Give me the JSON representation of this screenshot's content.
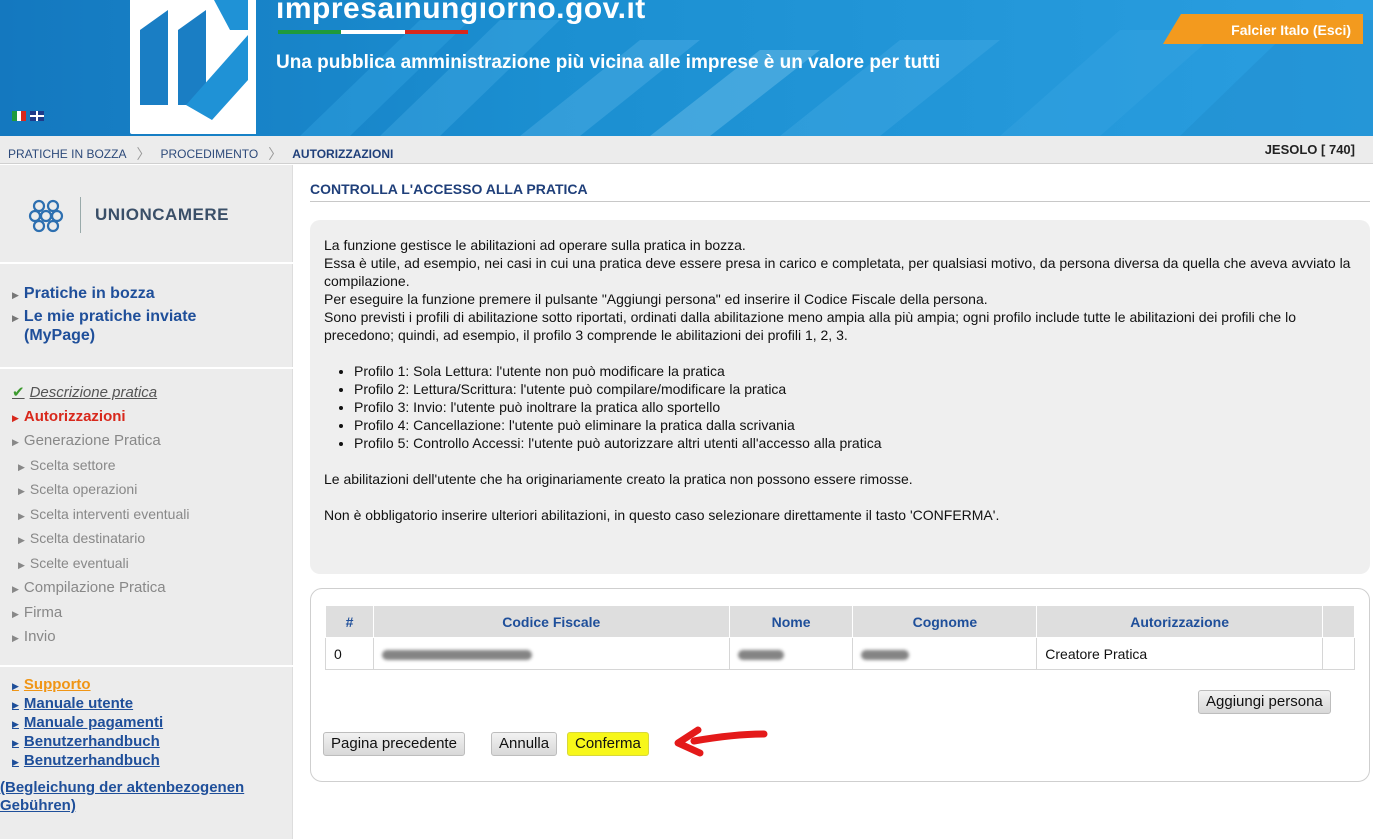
{
  "header": {
    "site_name": "impresainungiorno.gov.it",
    "tagline": "Una pubblica amministrazione più vicina alle imprese è un valore per tutti",
    "user_button": "Falcier Italo (Esci)",
    "flags": [
      "flag-it-icon",
      "flag-uk-icon"
    ]
  },
  "breadcrumb": {
    "items": [
      "PRATICHE IN BOZZA",
      "PROCEDIMENTO",
      "AUTORIZZAZIONI"
    ],
    "location": "JESOLO [ 740]"
  },
  "sidebar": {
    "brand": "UNIONCAMERE",
    "nav": [
      "Pratiche in bozza",
      "Le mie pratiche inviate",
      "(MyPage)"
    ],
    "steps": [
      "Descrizione pratica",
      "Autorizzazioni",
      "Generazione Pratica",
      "Scelta settore",
      "Scelta operazioni",
      "Scelta interventi eventuali",
      "Scelta destinatario",
      "Scelte eventuali",
      "Compilazione Pratica",
      "Firma",
      "Invio"
    ],
    "support": [
      "Supporto",
      "Manuale utente",
      "Manuale pagamenti",
      "Benutzerhandbuch",
      "Benutzerhandbuch"
    ],
    "support_extra": "(Begleichung der aktenbezogenen Gebühren)"
  },
  "main": {
    "title": "CONTROLLA L'ACCESSO ALLA PRATICA",
    "intro": [
      "La funzione gestisce le abilitazioni ad operare sulla pratica in bozza.",
      "Essa è utile, ad esempio, nei casi in cui una pratica deve essere presa in carico e completata, per qualsiasi motivo, da persona diversa da quella che aveva avviato la compilazione.",
      "Per eseguire la funzione premere il pulsante \"Aggiungi persona\" ed inserire il Codice Fiscale della persona.",
      "Sono previsti i profili di abilitazione sotto riportati, ordinati dalla abilitazione meno ampia alla più ampia; ogni profilo include tutte le abilitazioni dei profili che lo precedono; quindi, ad esempio, il profilo 3 comprende le abilitazioni dei profili 1, 2, 3."
    ],
    "profiles": [
      "Profilo 1: Sola Lettura: l'utente non può modificare la pratica",
      "Profilo 2: Lettura/Scrittura: l'utente può compilare/modificare la pratica",
      "Profilo 3: Invio: l'utente può inoltrare la pratica allo sportello",
      "Profilo 4: Cancellazione: l'utente può eliminare la pratica dalla scrivania",
      "Profilo 5: Controllo Accessi: l'utente può autorizzare altri utenti all'accesso alla pratica"
    ],
    "note1": "Le abilitazioni dell'utente che ha originariamente creato la pratica non possono essere rimosse.",
    "note2": "Non è obbligatorio inserire ulteriori abilitazioni, in questo caso selezionare direttamente il tasto 'CONFERMA'.",
    "table": {
      "headers": [
        "#",
        "Codice Fiscale",
        "Nome",
        "Cognome",
        "Autorizzazione",
        ""
      ],
      "rows": [
        {
          "num": "0",
          "authorization": "Creatore Pratica"
        }
      ]
    },
    "buttons": {
      "add_person": "Aggiungi persona",
      "previous": "Pagina precedente",
      "cancel": "Annulla",
      "confirm": "Conferma"
    }
  },
  "colors": {
    "header_blue": "#1b8fd1",
    "accent_orange": "#f39a1e",
    "link_blue": "#1f4f9a",
    "current_step_red": "#d8281c",
    "highlight_yellow": "#f7f71a"
  }
}
